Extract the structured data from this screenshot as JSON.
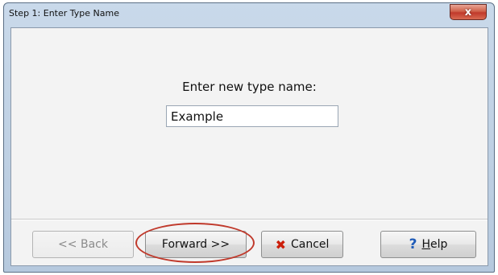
{
  "window": {
    "title": "Step 1: Enter Type Name",
    "close_glyph": "x"
  },
  "content": {
    "prompt": "Enter new type name:",
    "type_name_value": "Example"
  },
  "buttons": {
    "back": "<< Back",
    "forward": "Forward >>",
    "cancel": "Cancel",
    "help_accel": "H",
    "help_rest": "elp"
  },
  "icons": {
    "cancel": "x-mark-icon",
    "help": "question-mark-icon"
  },
  "annotation": {
    "highlight_color": "#c0392b"
  }
}
